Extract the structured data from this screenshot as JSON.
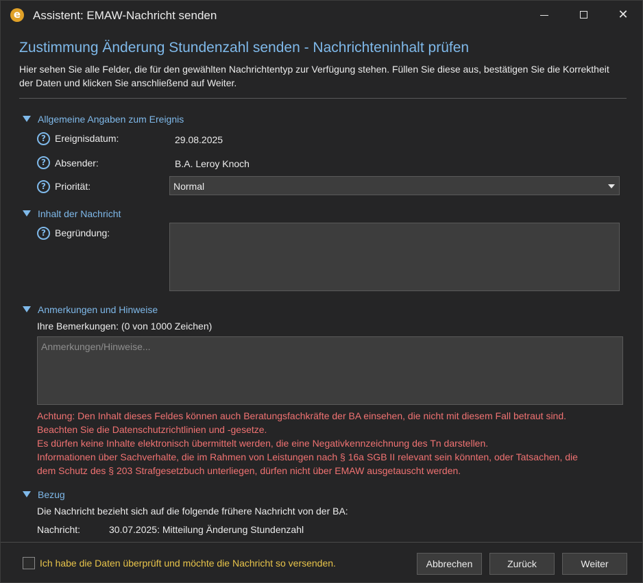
{
  "window": {
    "title": "Assistent: EMAW-Nachricht senden",
    "logo_letter": "e",
    "accent_color": "#7fb9ea",
    "warning_color": "#f07272",
    "checkbox_label_color": "#e8c44a"
  },
  "heading": {
    "title": "Zustimmung Änderung Stundenzahl senden - Nachrichteninhalt prüfen",
    "description": "Hier sehen Sie alle Felder, die für den gewählten Nachrichtentyp zur Verfügung stehen. Füllen Sie diese aus, bestätigen Sie die Korrektheit der Daten und klicken Sie anschließend auf Weiter."
  },
  "sections": {
    "general": {
      "title": "Allgemeine Angaben zum Ereignis",
      "event_date_label": "Ereignisdatum:",
      "event_date_value": "29.08.2025",
      "sender_label": "Absender:",
      "sender_value": "B.A. Leroy Knoch",
      "priority_label": "Priorität:",
      "priority_value": "Normal"
    },
    "content": {
      "title": "Inhalt der Nachricht",
      "reason_label": "Begründung:",
      "reason_value": ""
    },
    "remarks": {
      "title": "Anmerkungen und Hinweise",
      "counter_label": "Ihre Bemerkungen: (0 von 1000 Zeichen)",
      "placeholder": "Anmerkungen/Hinweise...",
      "warning_lines": [
        "Achtung: Den Inhalt dieses Feldes können auch Beratungsfachkräfte der BA einsehen, die nicht mit diesem Fall betraut sind.",
        "Beachten Sie die Datenschutzrichtlinien und -gesetze.",
        "Es dürfen keine Inhalte elektronisch übermittelt werden, die eine Negativkennzeichnung des Tn darstellen.",
        "Informationen über Sachverhalte, die im Rahmen von Leistungen nach § 16a SGB II relevant sein könnten, oder Tatsachen, die",
        "dem Schutz des § 203 Strafgesetzbuch unterliegen, dürfen nicht über EMAW ausgetauscht werden."
      ]
    },
    "reference": {
      "title": "Bezug",
      "intro": "Die Nachricht bezieht sich auf die folgende frühere Nachricht von der BA:",
      "message_label": "Nachricht:",
      "message_value": "30.07.2025: Mitteilung Änderung Stundenzahl"
    }
  },
  "footer": {
    "confirm_label": "Ich habe die Daten überprüft und möchte die Nachricht so versenden.",
    "confirm_checked": false,
    "cancel_label": "Abbrechen",
    "back_label": "Zurück",
    "next_label": "Weiter"
  }
}
